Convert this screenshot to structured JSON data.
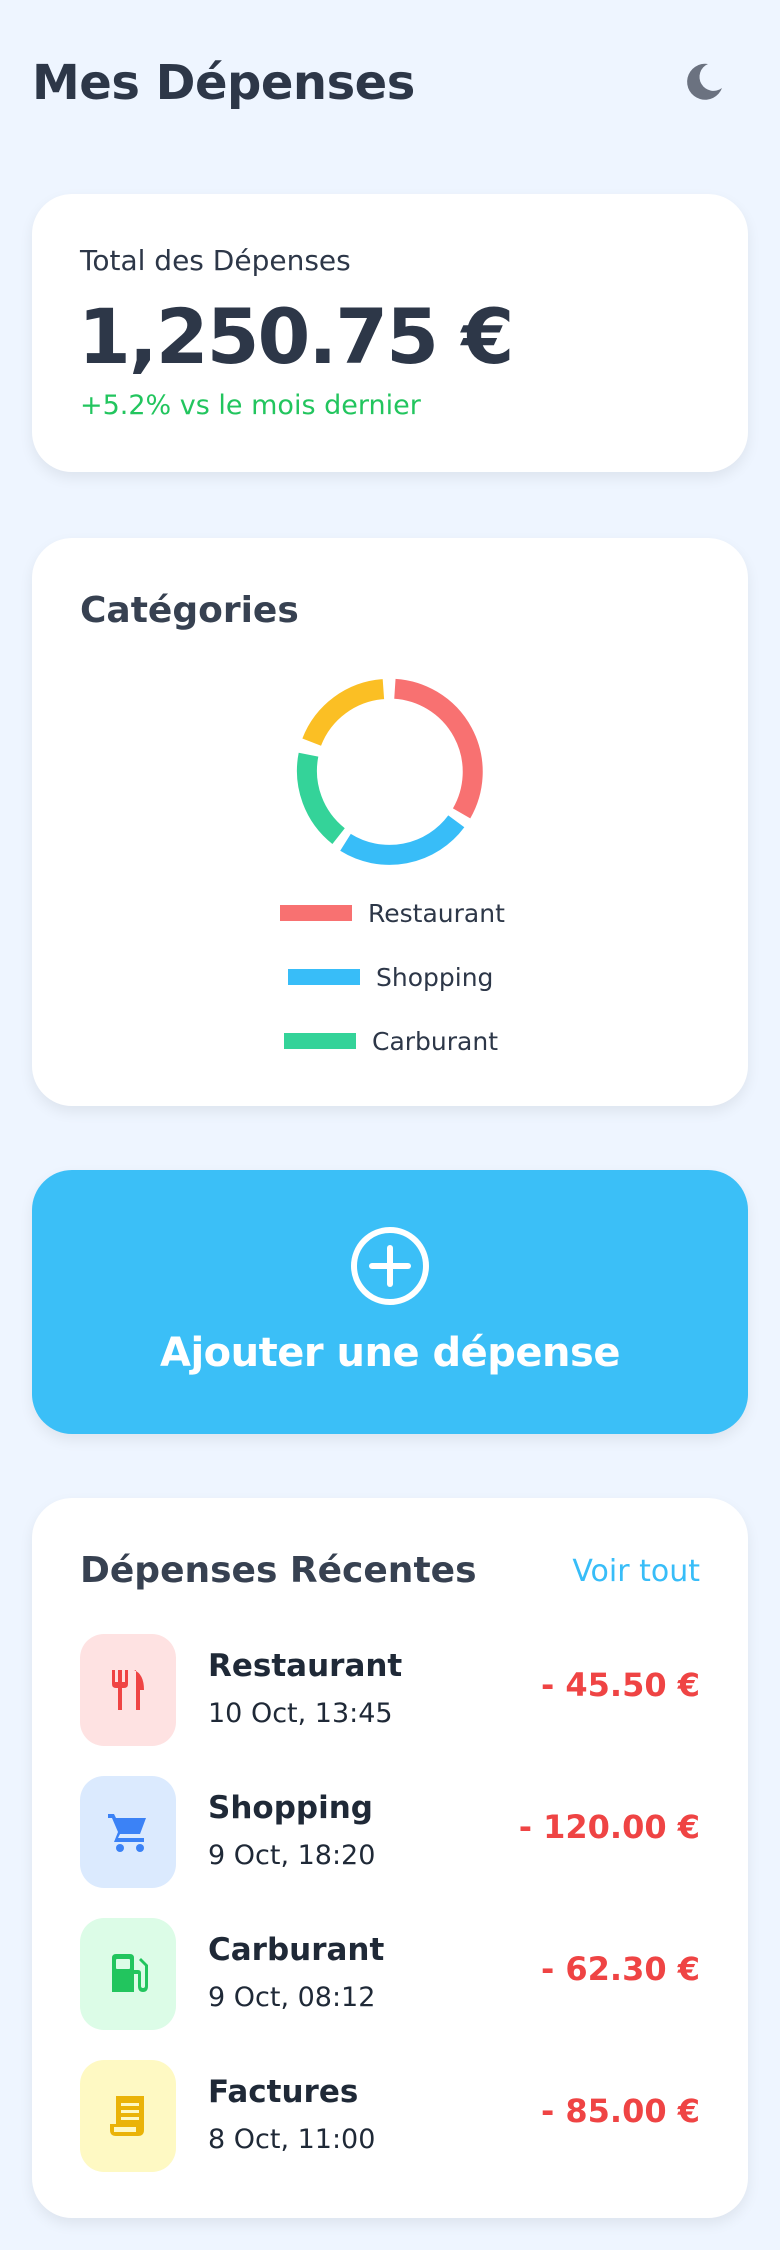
{
  "header": {
    "title": "Mes Dépenses",
    "theme_icon": "moon-icon"
  },
  "total": {
    "label": "Total des Dépenses",
    "amount": "1,250.75 €",
    "trend": "+5.2% vs le mois dernier",
    "trend_color": "#22c55e"
  },
  "categories": {
    "title": "Catégories",
    "legend": [
      {
        "label": "Restaurant",
        "color": "#f87171"
      },
      {
        "label": "Shopping",
        "color": "#38bdf8"
      },
      {
        "label": "Carburant",
        "color": "#34d399"
      }
    ],
    "donut_colors": [
      "#f87171",
      "#38bdf8",
      "#34d399",
      "#fbbf24"
    ]
  },
  "add_expense": {
    "label": "Ajouter une dépense",
    "icon": "plus-circle-icon",
    "color": "#3bbff7"
  },
  "recent": {
    "title": "Dépenses Récentes",
    "see_all": "Voir tout",
    "items": [
      {
        "name": "Restaurant",
        "date": "10 Oct, 13:45",
        "amount": "- 45.50 €",
        "icon": "fork-knife-icon",
        "icon_color": "#ef4444",
        "bg": "#fee2e2"
      },
      {
        "name": "Shopping",
        "date": "9 Oct, 18:20",
        "amount": "- 120.00 €",
        "icon": "shopping-cart-icon",
        "icon_color": "#3b82f6",
        "bg": "#dbeafe"
      },
      {
        "name": "Carburant",
        "date": "9 Oct, 08:12",
        "amount": "- 62.30 €",
        "icon": "fuel-pump-icon",
        "icon_color": "#22c55e",
        "bg": "#dcfce7"
      },
      {
        "name": "Factures",
        "date": "8 Oct, 11:00",
        "amount": "- 85.00 €",
        "icon": "receipt-icon",
        "icon_color": "#eab308",
        "bg": "#fef9c3"
      }
    ]
  }
}
